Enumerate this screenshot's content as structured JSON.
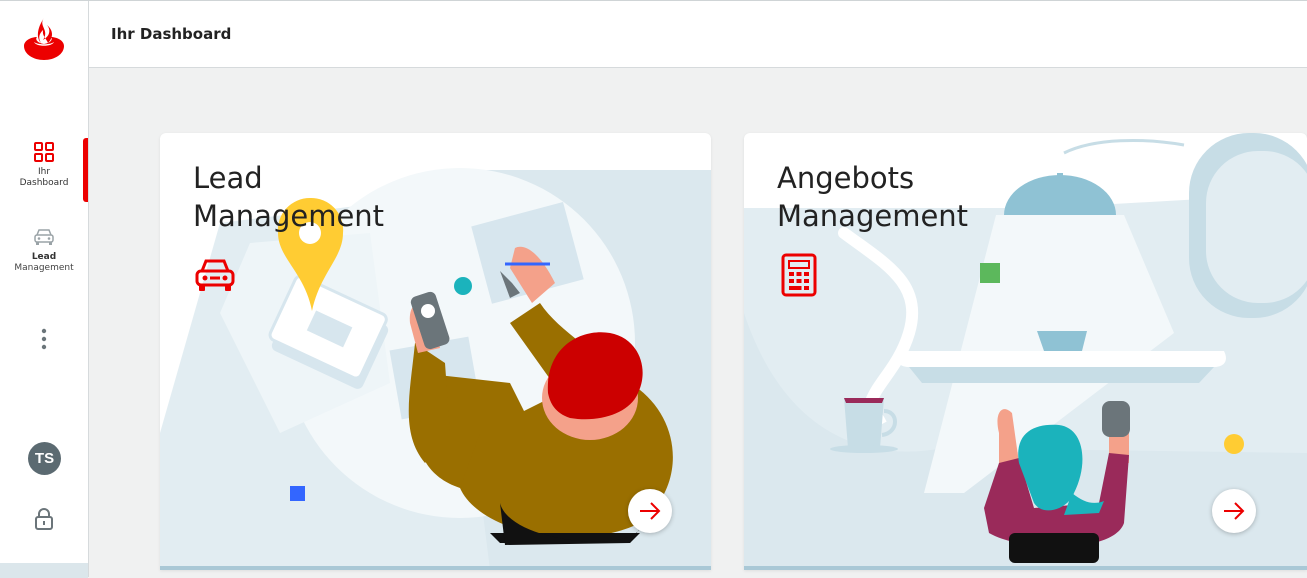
{
  "sidebar": {
    "logo": "santander-flame-icon",
    "items": [
      {
        "line1": "Ihr",
        "line2": "Dashboard",
        "icon": "grid-icon",
        "active": true
      },
      {
        "line1": "Lead",
        "line2": "Management",
        "icon": "car-icon",
        "active": false
      }
    ],
    "more_icon": "more-vertical-icon",
    "user_initials": "TS",
    "lock_icon": "lock-icon"
  },
  "header": {
    "title": "Ihr Dashboard"
  },
  "cards": [
    {
      "title_line1": "Lead",
      "title_line2": "Management",
      "icon": "car-icon",
      "arrow_icon": "arrow-right-icon"
    },
    {
      "title_line1": "Angebots",
      "title_line2": "Management",
      "icon": "calculator-icon",
      "arrow_icon": "arrow-right-icon"
    }
  ],
  "colors": {
    "brand_red": "#ec0000",
    "background": "#f0f1f1",
    "illustration_light": "#deebf0",
    "avatar": "#5b6a71"
  }
}
